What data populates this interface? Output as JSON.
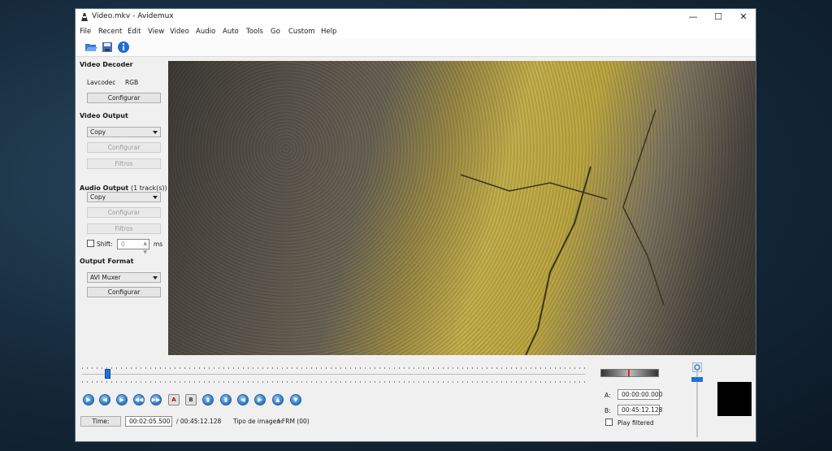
{
  "window": {
    "title": "Video.mkv - Avidemux"
  },
  "menu": [
    "File",
    "Recent",
    "Edit",
    "View",
    "Video",
    "Audio",
    "Auto",
    "Tools",
    "Go",
    "Custom",
    "Help"
  ],
  "video_decoder": {
    "heading": "Video Decoder",
    "codec": "Lavcodec",
    "colorspace": "RGB",
    "configure": "Configurar"
  },
  "video_output": {
    "heading": "Video Output",
    "codec": "Copy",
    "configure": "Configurar",
    "filters": "Filtros"
  },
  "audio_output": {
    "heading": "Audio Output",
    "tracks": "(1 track(s))",
    "codec": "Copy",
    "configure": "Configurar",
    "filters": "Filtros",
    "shift_label": "Shift:",
    "shift_value": "0",
    "shift_unit": "ms"
  },
  "output_format": {
    "heading": "Output Format",
    "muxer": "AVI Muxer",
    "configure": "Configurar"
  },
  "timeline": {
    "position_fraction": 0.05
  },
  "status": {
    "time_button": "Time:",
    "current_time": "00:02:05.500",
    "total_time": "/ 00:45:12.128",
    "frame_type_label": "Tipo de imagen:",
    "frame_type_value": "I-FRM (00)"
  },
  "markers": {
    "a_label": "A:",
    "a_value": "00:00:00.000",
    "b_label": "B:",
    "b_value": "00:45:12.128",
    "play_filtered": "Play filtered"
  },
  "controls": [
    "play",
    "rewind",
    "forward",
    "prev-keyframe",
    "next-keyframe",
    "marker-a",
    "marker-b",
    "prev-frame",
    "next-frame",
    "prev-black",
    "next-black",
    "first-frame",
    "last-frame"
  ]
}
